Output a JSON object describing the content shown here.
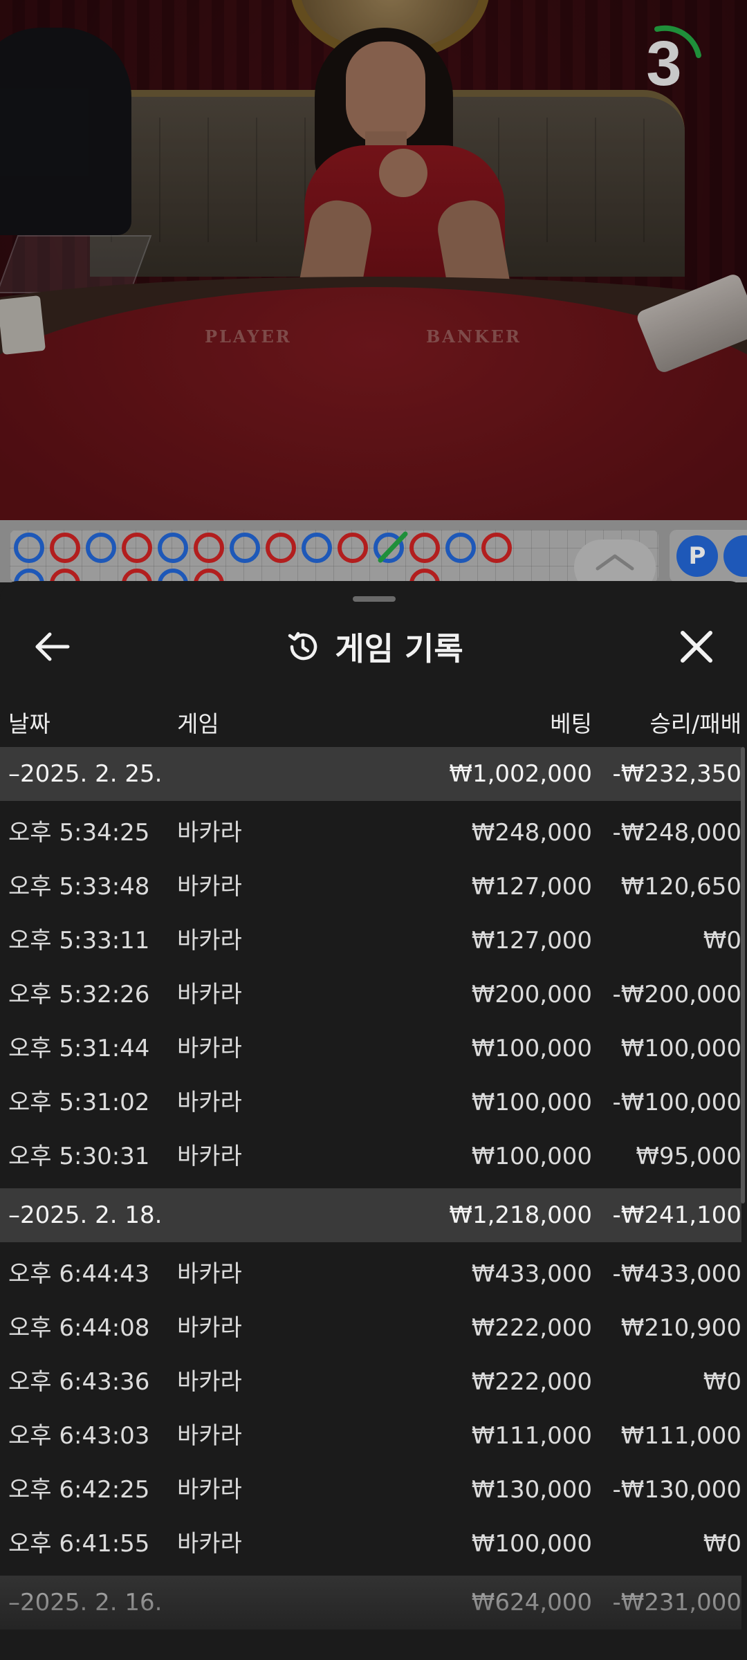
{
  "stream": {
    "countdown": "3",
    "table_labels": {
      "player": "PLAYER",
      "banker": "BANKER"
    }
  },
  "roadmap": {
    "beads_top": [
      "b",
      "r",
      "b",
      "r",
      "b",
      "r",
      "b",
      "r",
      "b",
      "r",
      "b",
      "r",
      "b",
      "r"
    ],
    "beads_bottom": [
      "b",
      "r",
      "",
      "r",
      "b",
      "r",
      "",
      "",
      "",
      "",
      "",
      "r",
      "",
      ""
    ],
    "predict_label": "P"
  },
  "sheet": {
    "title": "게임 기록",
    "columns": {
      "date": "날짜",
      "game": "게임",
      "bet": "베팅",
      "result": "승리/패배"
    },
    "groups": [
      {
        "date": "–2025. 2. 25.",
        "bet_total": "₩1,002,000",
        "result_total": "-₩232,350",
        "rows": [
          {
            "time": "오후 5:34:25",
            "game": "바카라",
            "bet": "₩248,000",
            "result": "-₩248,000"
          },
          {
            "time": "오후 5:33:48",
            "game": "바카라",
            "bet": "₩127,000",
            "result": "₩120,650"
          },
          {
            "time": "오후 5:33:11",
            "game": "바카라",
            "bet": "₩127,000",
            "result": "₩0"
          },
          {
            "time": "오후 5:32:26",
            "game": "바카라",
            "bet": "₩200,000",
            "result": "-₩200,000"
          },
          {
            "time": "오후 5:31:44",
            "game": "바카라",
            "bet": "₩100,000",
            "result": "₩100,000"
          },
          {
            "time": "오후 5:31:02",
            "game": "바카라",
            "bet": "₩100,000",
            "result": "-₩100,000"
          },
          {
            "time": "오후 5:30:31",
            "game": "바카라",
            "bet": "₩100,000",
            "result": "₩95,000"
          }
        ]
      },
      {
        "date": "–2025. 2. 18.",
        "bet_total": "₩1,218,000",
        "result_total": "-₩241,100",
        "rows": [
          {
            "time": "오후 6:44:43",
            "game": "바카라",
            "bet": "₩433,000",
            "result": "-₩433,000"
          },
          {
            "time": "오후 6:44:08",
            "game": "바카라",
            "bet": "₩222,000",
            "result": "₩210,900"
          },
          {
            "time": "오후 6:43:36",
            "game": "바카라",
            "bet": "₩222,000",
            "result": "₩0"
          },
          {
            "time": "오후 6:43:03",
            "game": "바카라",
            "bet": "₩111,000",
            "result": "₩111,000"
          },
          {
            "time": "오후 6:42:25",
            "game": "바카라",
            "bet": "₩130,000",
            "result": "-₩130,000"
          },
          {
            "time": "오후 6:41:55",
            "game": "바카라",
            "bet": "₩100,000",
            "result": "₩0"
          }
        ]
      },
      {
        "date": "–2025. 2. 16.",
        "bet_total": "₩624,000",
        "result_total": "-₩231,000",
        "rows": []
      }
    ]
  }
}
